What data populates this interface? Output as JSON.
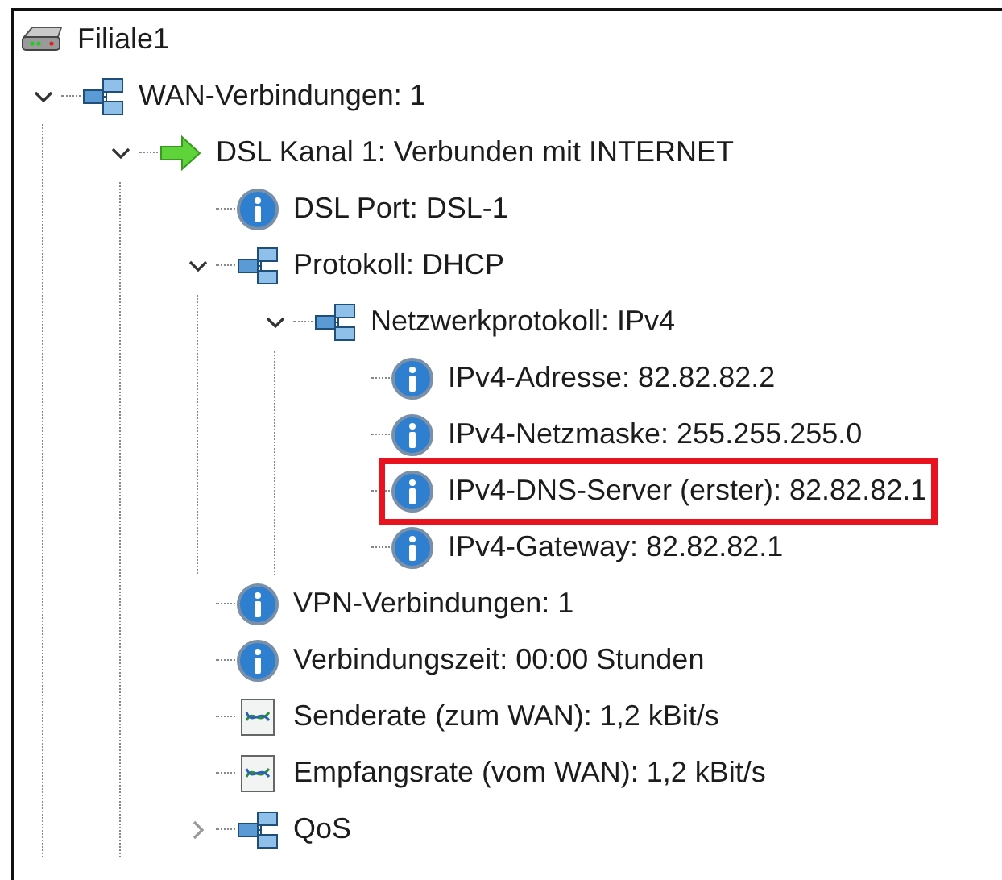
{
  "tree": {
    "label": "Filiale1",
    "kind": "device",
    "children": [
      {
        "label": "WAN-Verbindungen: 1",
        "kind": "network",
        "expanded": true,
        "children": [
          {
            "label": "DSL Kanal 1: Verbunden mit INTERNET",
            "kind": "arrow",
            "expanded": true,
            "children": [
              {
                "label": "DSL Port: DSL-1",
                "kind": "info"
              },
              {
                "label": "Protokoll: DHCP",
                "kind": "network",
                "expanded": true,
                "children": [
                  {
                    "label": "Netzwerkprotokoll: IPv4",
                    "kind": "network",
                    "expanded": true,
                    "children": [
                      {
                        "label": "IPv4-Adresse: 82.82.82.2",
                        "kind": "info",
                        "highlighted": false
                      },
                      {
                        "label": "IPv4-Netzmaske: 255.255.255.0",
                        "kind": "info",
                        "highlighted": false
                      },
                      {
                        "label": "IPv4-DNS-Server (erster): 82.82.82.1",
                        "kind": "info",
                        "highlighted": true
                      },
                      {
                        "label": "IPv4-Gateway: 82.82.82.1",
                        "kind": "info",
                        "highlighted": false
                      }
                    ]
                  }
                ]
              },
              {
                "label": "VPN-Verbindungen: 1",
                "kind": "info"
              },
              {
                "label": "Verbindungszeit: 00:00 Stunden",
                "kind": "info"
              },
              {
                "label": "Senderate (zum WAN): 1,2 kBit/s",
                "kind": "chart"
              },
              {
                "label": "Empfangsrate (vom WAN): 1,2 kBit/s",
                "kind": "chart"
              },
              {
                "label": "QoS",
                "kind": "network",
                "expanded": false
              }
            ]
          }
        ]
      }
    ]
  }
}
